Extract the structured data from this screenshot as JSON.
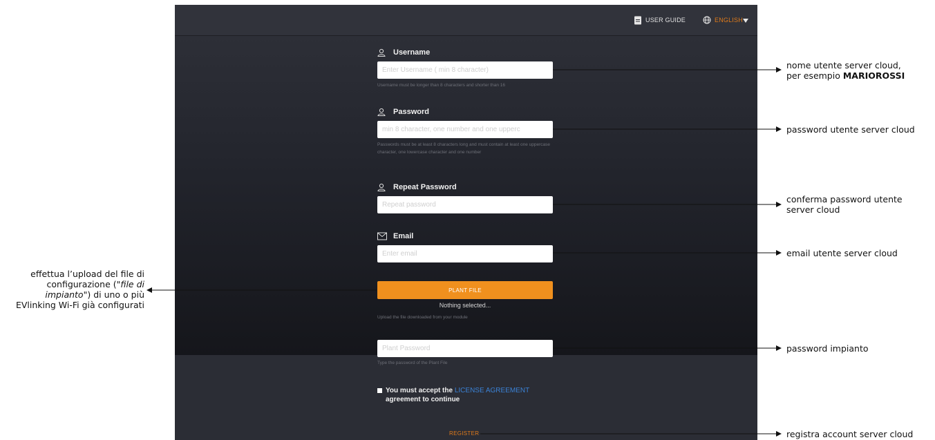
{
  "topbar": {
    "user_guide": "USER GUIDE",
    "language": "ENGLISH",
    "icons": [
      "document-icon",
      "globe-icon",
      "caret-down-icon"
    ]
  },
  "form": {
    "username": {
      "label": "Username",
      "placeholder": "Enter Username ( min 8 character)",
      "hint": "Username must be longer than 8 characters and shorter than 16"
    },
    "password": {
      "label": "Password",
      "placeholder": "min 8 character, one number and one upperc",
      "hint": "Passwords must be at least 8 characters long and must contain at least one uppercase character, one lowercase character and one number"
    },
    "repeat_password": {
      "label": "Repeat Password",
      "placeholder": "Repeat password"
    },
    "email": {
      "label": "Email",
      "placeholder": "Enter email"
    },
    "plant_file": {
      "button": "PLANT FILE",
      "status": "Nothing selected...",
      "hint": "Upload the file downloaded from your module"
    },
    "plant_password": {
      "placeholder": "Plant Password",
      "hint": "Type the password of the Plant File"
    },
    "license": {
      "prefix": "You must accept the",
      "link": "LICENSE AGREEMENT",
      "suffix": "agreement to continue"
    },
    "register": "REGISTER"
  },
  "annotations": {
    "username_line1": "nome utente server cloud,",
    "username_line2_prefix": "per esempio",
    "username_line2_bold": "MARIOROSSI",
    "password": "password utente server cloud",
    "repeat_line1": "conferma password utente",
    "repeat_line2": "server cloud",
    "email": "email utente server cloud",
    "upload_line1": "effettua l’upload del file di",
    "upload_line2_prefix": "configurazione (\"",
    "upload_line2_italic": "file di",
    "upload_line3_italic": "impianto",
    "upload_line3_suffix": "\") di uno o più",
    "upload_line4": "EVlinking Wi-Fi già configurati",
    "plant_password": "password impianto",
    "register": "registra account server cloud"
  },
  "colors": {
    "accent_orange": "#f0901e",
    "link_blue": "#3b82d6",
    "panel_dark": "#2b2d35"
  }
}
